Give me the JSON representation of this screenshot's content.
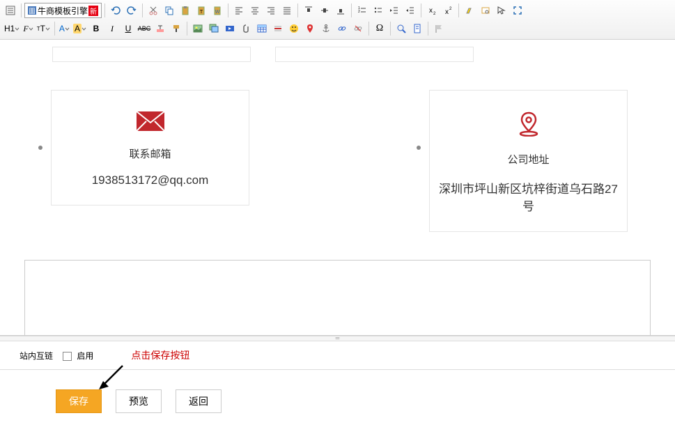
{
  "toolbar": {
    "template_btn": "牛商模板引擎",
    "template_badge": "新",
    "h1_label": "H1",
    "font_family_label": "F",
    "font_size_label": "T",
    "font_color_label": "A",
    "highlight_label": "A"
  },
  "content": {
    "cards": [
      {
        "title": "联系邮箱",
        "text": "1938513172@qq.com",
        "icon": "envelope"
      },
      {
        "title": "公司地址",
        "text": "深圳市坪山新区坑梓街道乌石路27号",
        "icon": "map-pin"
      }
    ]
  },
  "options": {
    "internal_link_label": "站内互链",
    "enable_label": "启用",
    "hint": "点击保存按钮"
  },
  "buttons": {
    "save": "保存",
    "preview": "预览",
    "back": "返回"
  }
}
